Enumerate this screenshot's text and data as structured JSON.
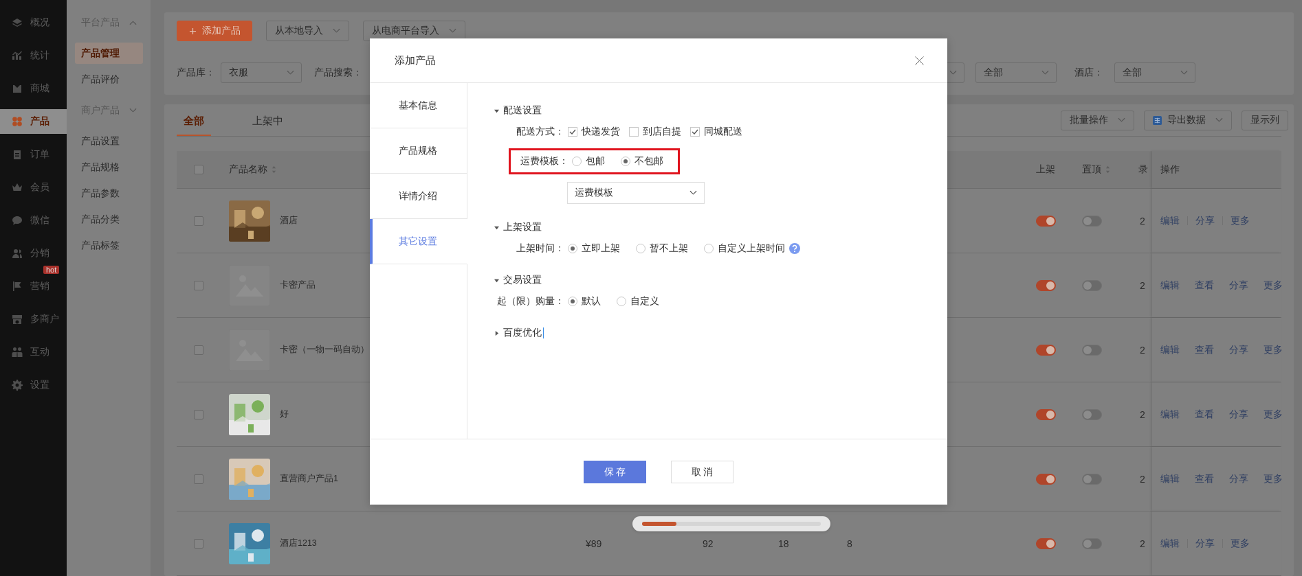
{
  "nav": {
    "items": [
      {
        "label": "概况",
        "selected": false
      },
      {
        "label": "统计",
        "selected": false
      },
      {
        "label": "商城",
        "selected": false
      },
      {
        "label": "产品",
        "selected": true
      },
      {
        "label": "订单",
        "selected": false
      },
      {
        "label": "会员",
        "selected": false
      },
      {
        "label": "微信",
        "selected": false
      },
      {
        "label": "分销",
        "selected": false
      },
      {
        "label": "营销",
        "selected": false,
        "badge": "hot"
      },
      {
        "label": "多商户",
        "selected": false
      },
      {
        "label": "互动",
        "selected": false
      },
      {
        "label": "设置",
        "selected": false
      }
    ]
  },
  "subnav": {
    "items": [
      {
        "kind": "group",
        "label": "平台产品",
        "expanded": true
      },
      {
        "kind": "link",
        "label": "产品管理",
        "selected": true
      },
      {
        "kind": "link",
        "label": "产品评价",
        "selected": false
      },
      {
        "kind": "group",
        "label": "商户产品",
        "expanded": false
      },
      {
        "kind": "link",
        "label": "产品设置",
        "selected": false
      },
      {
        "kind": "link",
        "label": "产品规格",
        "selected": false
      },
      {
        "kind": "link",
        "label": "产品参数",
        "selected": false
      },
      {
        "kind": "link",
        "label": "产品分类",
        "selected": false
      },
      {
        "kind": "link",
        "label": "产品标签",
        "selected": false
      }
    ]
  },
  "toolbar": {
    "buttons": [
      {
        "kind": "primary",
        "label": "添加产品"
      },
      {
        "kind": "dropdown",
        "label": "从本地导入"
      },
      {
        "kind": "dropdown",
        "label": "从电商平台导入"
      }
    ]
  },
  "filters": [
    {
      "label": "产品库：",
      "value": "衣服"
    },
    {
      "label": "产品搜索："
    },
    {
      "value": "全部"
    },
    {
      "label": "酒店：",
      "value": "全部"
    }
  ],
  "tabs": [
    {
      "label": "全部",
      "selected": true
    },
    {
      "label": "上架中",
      "selected": false
    }
  ],
  "table_actions": [
    {
      "kind": "dropdown",
      "label": "批量操作"
    },
    {
      "kind": "export",
      "label": "导出数据"
    },
    {
      "kind": "plain",
      "label": "显示列"
    }
  ],
  "table": {
    "all_checked": false,
    "columns": [
      {
        "label": "产品名称",
        "sortable": true
      },
      {
        "label": "上架"
      },
      {
        "label": "置顶",
        "sortable": true
      },
      {
        "label": "录"
      },
      {
        "label": "操作"
      }
    ],
    "rows": [
      {
        "checked": false,
        "thumb": {
          "kind": "picture"
        },
        "name": "酒店",
        "listed": true,
        "pinned": false,
        "column_9": "2",
        "actions": [
          "编辑",
          "分享",
          "更多"
        ]
      },
      {
        "checked": false,
        "thumb": {
          "kind": "placeholder"
        },
        "name": "卡密产品",
        "listed": true,
        "pinned": false,
        "column_9": "2",
        "actions": [
          "编辑",
          "查看",
          "分享",
          "更多"
        ]
      },
      {
        "checked": false,
        "thumb": {
          "kind": "placeholder"
        },
        "name": "卡密（一物一码自动）",
        "listed": true,
        "pinned": false,
        "column_9": "2",
        "actions": [
          "编辑",
          "查看",
          "分享",
          "更多"
        ]
      },
      {
        "checked": false,
        "thumb": {
          "kind": "picture"
        },
        "name": "好",
        "listed": true,
        "pinned": false,
        "column_9": "2",
        "actions": [
          "编辑",
          "查看",
          "分享",
          "更多"
        ]
      },
      {
        "checked": false,
        "thumb": {
          "kind": "picture"
        },
        "name": "直营商户产品1",
        "listed": true,
        "pinned": false,
        "column_9": "2",
        "actions": [
          "编辑",
          "查看",
          "分享",
          "更多"
        ]
      },
      {
        "checked": false,
        "thumb": {
          "kind": "picture"
        },
        "name": "酒店1213",
        "price": "¥89",
        "column_4": "92",
        "column_5": "18",
        "column_6": "8",
        "listed": true,
        "pinned": false,
        "column_9": "2",
        "actions": [
          "编辑",
          "分享",
          "更多"
        ]
      }
    ]
  },
  "modal": {
    "title": "添加产品",
    "tabs": [
      {
        "label": "基本信息",
        "selected": false
      },
      {
        "label": "产品规格",
        "selected": false
      },
      {
        "label": "详情介绍",
        "selected": false
      },
      {
        "label": "其它设置",
        "selected": true
      }
    ],
    "sections": [
      {
        "title": "配送设置",
        "expanded": true,
        "fields": [
          {
            "kind": "checkboxes",
            "label": "配送方式：",
            "options": [
              {
                "label": "快递发货",
                "checked": true
              },
              {
                "label": "到店自提",
                "checked": false
              },
              {
                "label": "同城配送",
                "checked": true
              }
            ]
          },
          {
            "kind": "radios",
            "label": "运费模板：",
            "highlighted": true,
            "options": [
              {
                "label": "包邮",
                "selected": false
              },
              {
                "label": "不包邮",
                "selected": true
              }
            ]
          },
          {
            "kind": "select",
            "value": "运费模板"
          }
        ]
      },
      {
        "title": "上架设置",
        "expanded": true,
        "fields": [
          {
            "kind": "radios",
            "label": "上架时间：",
            "help": true,
            "options": [
              {
                "label": "立即上架",
                "selected": true
              },
              {
                "label": "暂不上架",
                "selected": false
              },
              {
                "label": "自定义上架时间",
                "selected": false
              }
            ]
          }
        ]
      },
      {
        "title": "交易设置",
        "expanded": true,
        "fields": [
          {
            "kind": "radios",
            "label": "起（限）购量：",
            "options": [
              {
                "label": "默认",
                "selected": true
              },
              {
                "label": "自定义",
                "selected": false
              }
            ]
          }
        ]
      },
      {
        "title": "百度优化",
        "expanded": false,
        "cursor": true
      }
    ],
    "buttons": [
      {
        "kind": "primary",
        "label": "保 存"
      },
      {
        "kind": "default",
        "label": "取 消"
      }
    ]
  }
}
